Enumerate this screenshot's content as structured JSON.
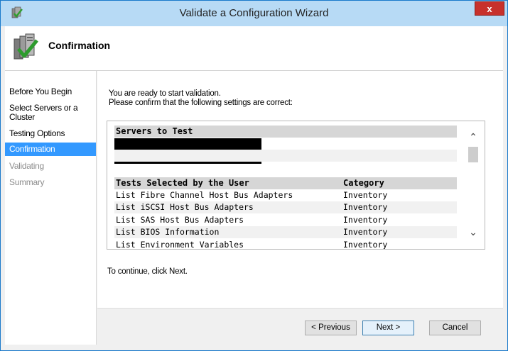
{
  "window": {
    "title": "Validate a Configuration Wizard",
    "close_label": "x"
  },
  "header": {
    "title": "Confirmation",
    "icon": "server-check-icon"
  },
  "nav": {
    "items": [
      {
        "label": "Before You Begin",
        "state": "done"
      },
      {
        "label": "Select Servers or a Cluster",
        "state": "done"
      },
      {
        "label": "Testing Options",
        "state": "done"
      },
      {
        "label": "Confirmation",
        "state": "active"
      },
      {
        "label": "Validating",
        "state": "disabled"
      },
      {
        "label": "Summary",
        "state": "disabled"
      }
    ]
  },
  "content": {
    "intro_line1": "You are ready to start validation.",
    "intro_line2": "Please confirm that the following settings are correct:",
    "continue_text": "To continue, click Next."
  },
  "report": {
    "servers_heading": "Servers to Test",
    "tests_heading": "Tests Selected by the User",
    "category_heading": "Category",
    "tests": [
      {
        "name": "List Fibre Channel Host Bus Adapters",
        "category": "Inventory"
      },
      {
        "name": "List iSCSI Host Bus Adapters",
        "category": "Inventory"
      },
      {
        "name": "List SAS Host Bus Adapters",
        "category": "Inventory"
      },
      {
        "name": "List BIOS Information",
        "category": "Inventory"
      },
      {
        "name": "List Environment Variables",
        "category": "Inventory"
      }
    ]
  },
  "buttons": {
    "previous": "Previous",
    "next": "Next >",
    "cancel": "Cancel"
  },
  "colors": {
    "titlebar": "#b7daf5",
    "nav_active": "#3399ff",
    "close": "#c7312c"
  }
}
